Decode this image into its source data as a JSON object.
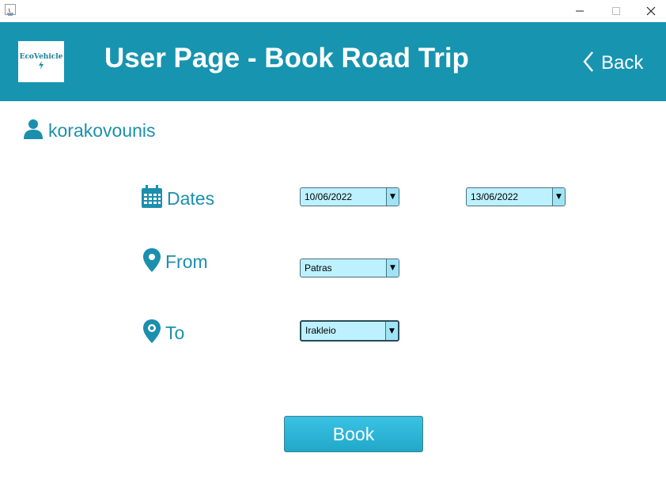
{
  "window": {
    "icons": {
      "app": "java-icon",
      "minimize": "minimize-icon",
      "maximize": "maximize-icon",
      "close": "close-icon"
    }
  },
  "header": {
    "logo_text": "EcoVehicle",
    "title": "User Page - Book Road Trip",
    "back_label": "Back",
    "colors": {
      "background": "#1794b0",
      "text": "#ffffff"
    }
  },
  "user": {
    "name": "korakovounis",
    "icon": "user-icon"
  },
  "form": {
    "dates": {
      "label": "Dates",
      "icon": "calendar-icon",
      "start_value": "10/06/2022",
      "end_value": "13/06/2022"
    },
    "from": {
      "label": "From",
      "icon": "map-pin-icon",
      "value": "Patras"
    },
    "to": {
      "label": "To",
      "icon": "map-pin-target-icon",
      "value": "Irakleio"
    }
  },
  "actions": {
    "book_label": "Book"
  },
  "colors": {
    "accent": "#1b8fae",
    "combo_bg": "#bdf1ff",
    "button": "#2ab4d6"
  }
}
